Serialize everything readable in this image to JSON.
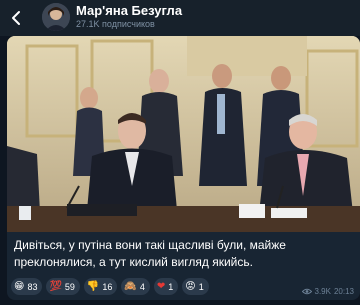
{
  "header": {
    "title": "Мар'яна Безугла",
    "subscribers": "27.1K подписчиков"
  },
  "message": {
    "caption": "Дивіться, у путіна вони такі щасливі були, майже преклонялися, а тут кислий вигляд якийсь.",
    "reactions": [
      {
        "icon": "grinning-face-emoji",
        "glyph": "😁",
        "count": "83"
      },
      {
        "icon": "hundred-points-emoji",
        "glyph": "💯",
        "count": "59"
      },
      {
        "icon": "thumbs-down-emoji",
        "glyph": "👎",
        "count": "16"
      },
      {
        "icon": "monkey-emoji",
        "glyph": "🙈",
        "count": "4"
      },
      {
        "icon": "red-heart-emoji",
        "glyph": "❤",
        "count": "1"
      },
      {
        "icon": "pouting-face-emoji",
        "glyph": "😡",
        "count": "1"
      }
    ],
    "views": "3.9K",
    "time": "20:13"
  },
  "colors": {
    "background": "#0e1621",
    "header": "#17212b",
    "bubble": "#182533",
    "reaction_bg": "#2b3a4b",
    "meta_text": "#6d8196"
  }
}
